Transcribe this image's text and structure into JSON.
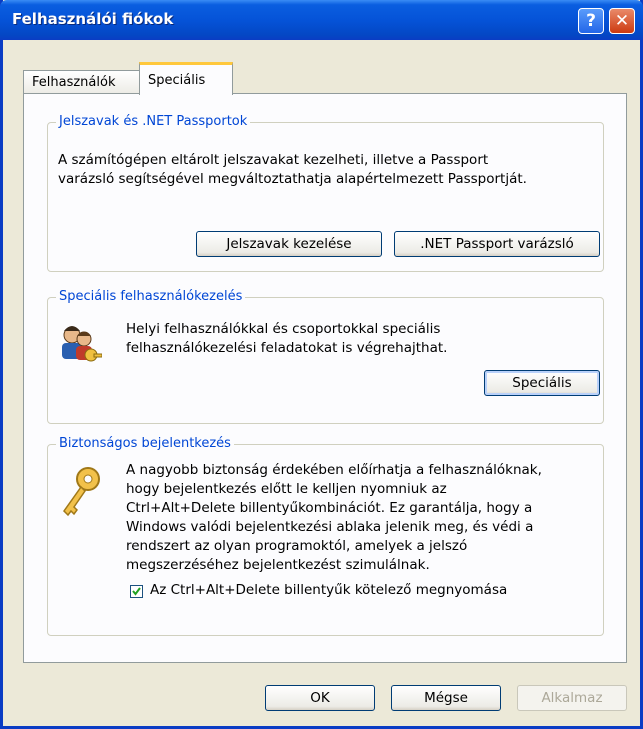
{
  "window": {
    "title": "Felhasználói fiókok",
    "help_glyph": "?",
    "close_glyph": "✕"
  },
  "tabs": [
    {
      "label": "Felhasználók"
    },
    {
      "label": "Speciális"
    }
  ],
  "passwords": {
    "title": "Jelszavak és .NET Passportok",
    "line1": "A számítógépen eltárolt jelszavakat kezelheti, illetve a Passport",
    "line2": "varázsló segítségével megváltoztathatja alapértelmezett Passportját.",
    "manage_label": "Jelszavak kezelése",
    "passport_label": ".NET Passport varázsló"
  },
  "advanced_users": {
    "title": "Speciális felhasználókezelés",
    "line1": "Helyi felhasználókkal és csoportokkal speciális",
    "line2": "felhasználókezelési feladatokat is végrehajthat.",
    "button_label": "Speciális"
  },
  "secure_logon": {
    "title": "Biztonságos bejelentkezés",
    "lines": [
      "A nagyobb biztonság érdekében előírhatja a felhasználóknak,",
      "hogy bejelentkezés előtt le kelljen nyomniuk az",
      "Ctrl+Alt+Delete billentyűkombinációt. Ez garantálja, hogy a",
      "Windows valódi bejelentkezési ablaka jelenik meg, és védi a",
      "rendszert az olyan programoktól, amelyek a jelszó",
      "megszerzéséhez bejelentkezést szimulálnak."
    ],
    "checkbox_label": "Az Ctrl+Alt+Delete billentyűk kötelező megnyomása",
    "checkbox_checked": true
  },
  "footer": {
    "ok_label": "OK",
    "cancel_label": "Mégse",
    "apply_label": "Alkalmaz"
  },
  "colors": {
    "accent": "#0046d5",
    "titlebar": "#0553d8"
  }
}
